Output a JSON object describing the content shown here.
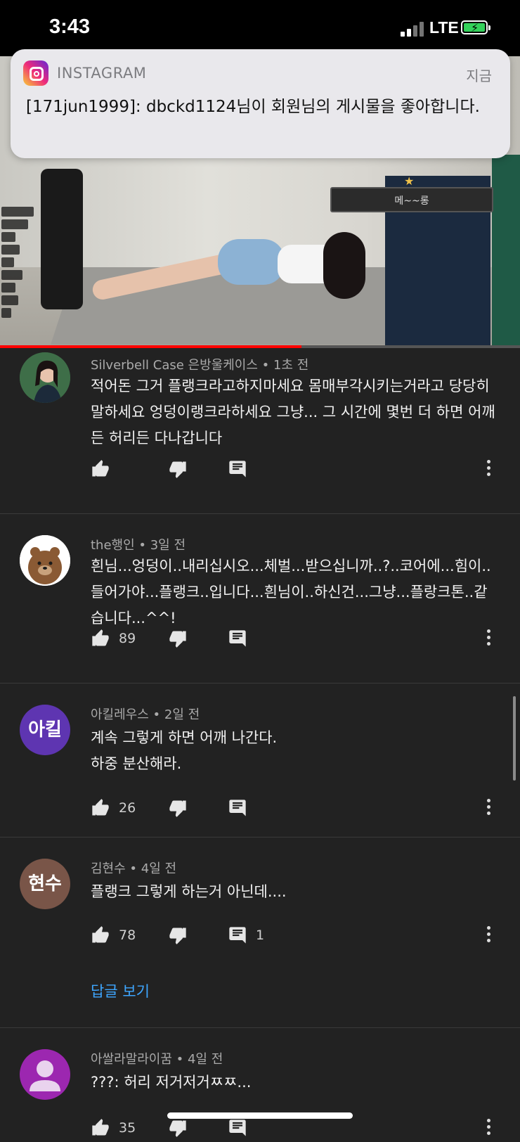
{
  "status_bar": {
    "time": "3:43",
    "network": "LTE",
    "battery_color": "#33d15a"
  },
  "notification": {
    "app_name": "INSTAGRAM",
    "time": "지금",
    "message": "[171jun1999]: dbckd1124님이 회원님의 게시물을 좋아합니다."
  },
  "video": {
    "name_plate": "메~~롱",
    "progress_fraction": 0.58,
    "progress_color": "#ff0000"
  },
  "comments": [
    {
      "author": "Silverbell Case 은방울케이스",
      "time": "1초 전",
      "text": "적어돈 그거 플랭크라고하지마세요 몸매부각시키는거라고 당당히 말하세요 엉덩이랭크라하세요 그냥... 그 시간에 몇번 더 하면 어깨든 허리든 다나갑니다",
      "likes": "",
      "replies_count": ""
    },
    {
      "author": "the행인",
      "time": "3일 전",
      "text": "흰님...엉덩이..내리십시오...체벌...받으십니까..?..코어에...힘이..들어가야...플랭크..입니다...흰님이..하신건...그냥...플랑크톤..같습니다...^^!",
      "likes": "89",
      "replies_count": ""
    },
    {
      "author": "아킬레우스",
      "time": "2일 전",
      "avatar_text": "아킬",
      "avatar_color": "#5e35b1",
      "text_lines": [
        "계속 그렇게 하면 어깨 나간다.",
        "하중 분산해라."
      ],
      "likes": "26",
      "replies_count": ""
    },
    {
      "author": "김현수",
      "time": "4일 전",
      "avatar_text": "현수",
      "avatar_color": "#795548",
      "text": "플랭크 그렇게 하는거 아닌데....",
      "likes": "78",
      "replies_count": "1",
      "view_replies": "답글 보기"
    },
    {
      "author": "아쌀라말라이꿈",
      "time": "4일 전",
      "avatar_color": "#9c27b0",
      "text": "???: 허리 저거저거ㅉㅉ...",
      "likes": "35",
      "replies_count": ""
    }
  ],
  "icons": {
    "like": "thumbs-up-icon",
    "dislike": "thumbs-down-icon",
    "reply": "reply-icon",
    "more": "more-vert-icon"
  }
}
